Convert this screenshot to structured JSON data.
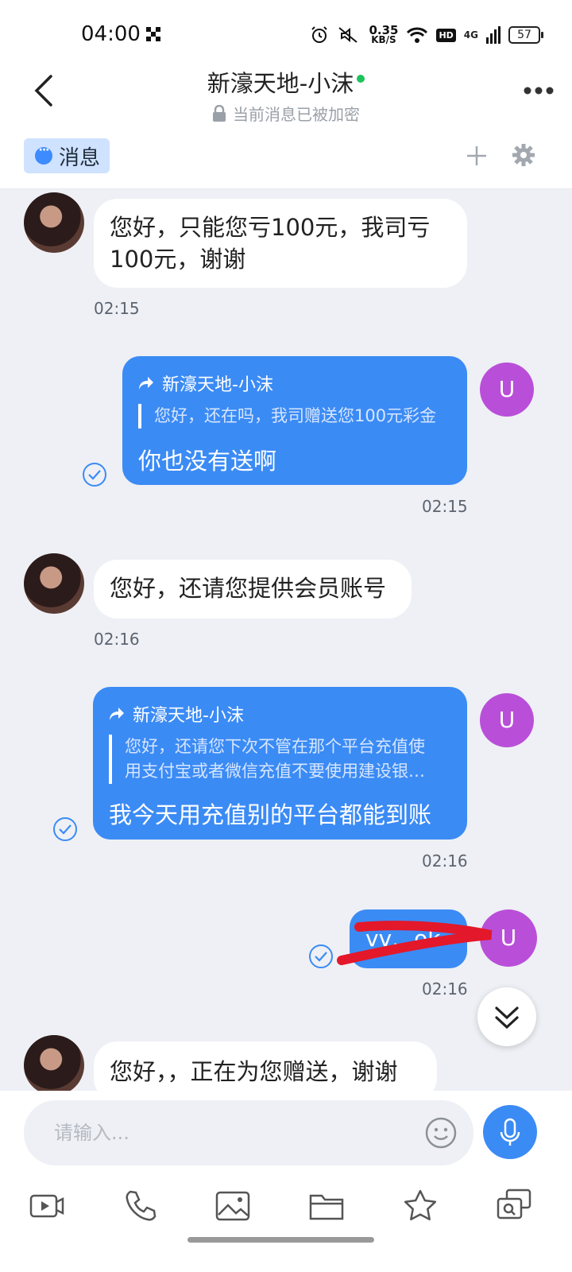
{
  "status_bar": {
    "time": "04:00",
    "speed_value": "0.35",
    "speed_unit": "KB/S",
    "hd_label": "HD",
    "network": "4G",
    "battery": "57"
  },
  "header": {
    "title": "新濠天地-小沫",
    "subtitle": "当前消息已被加密"
  },
  "tabs": {
    "messages_label": "消息"
  },
  "messages": [
    {
      "text": "您好，只能您亏100元，我司亏100元，谢谢",
      "line1": "您好，只能您亏100元，我司亏",
      "line2": "100元，谢谢",
      "time": "02:15"
    },
    {
      "forward_from": "新濠天地-小沫",
      "quote": "您好，还在吗，我司赠送您100元彩金",
      "text": "你也没有送啊",
      "time": "02:15",
      "avatar_letter": "U"
    },
    {
      "text": "您好，还请您提供会员账号",
      "time": "02:16"
    },
    {
      "forward_from": "新濠天地-小沫",
      "quote_line1": "您好，还请您下次不管在那个平台充值使",
      "quote_line2": "用支付宝或者微信充值不要使用建设银…",
      "text": "我今天用充值别的平台都能到账",
      "time": "02:16",
      "avatar_letter": "U"
    },
    {
      "text": "vv…ok",
      "time": "02:16",
      "avatar_letter": "U"
    },
    {
      "text": "您好，，正在为您赠送，谢谢"
    }
  ],
  "input": {
    "placeholder": "请输入..."
  },
  "colors": {
    "accent": "#3b8bf5",
    "user_avatar": "#b94fd8",
    "online": "#1ec25d",
    "background": "#eef0f5"
  },
  "toolbar_icons": [
    "video-icon",
    "phone-icon",
    "image-icon",
    "folder-icon",
    "star-icon",
    "search-chat-icon"
  ]
}
